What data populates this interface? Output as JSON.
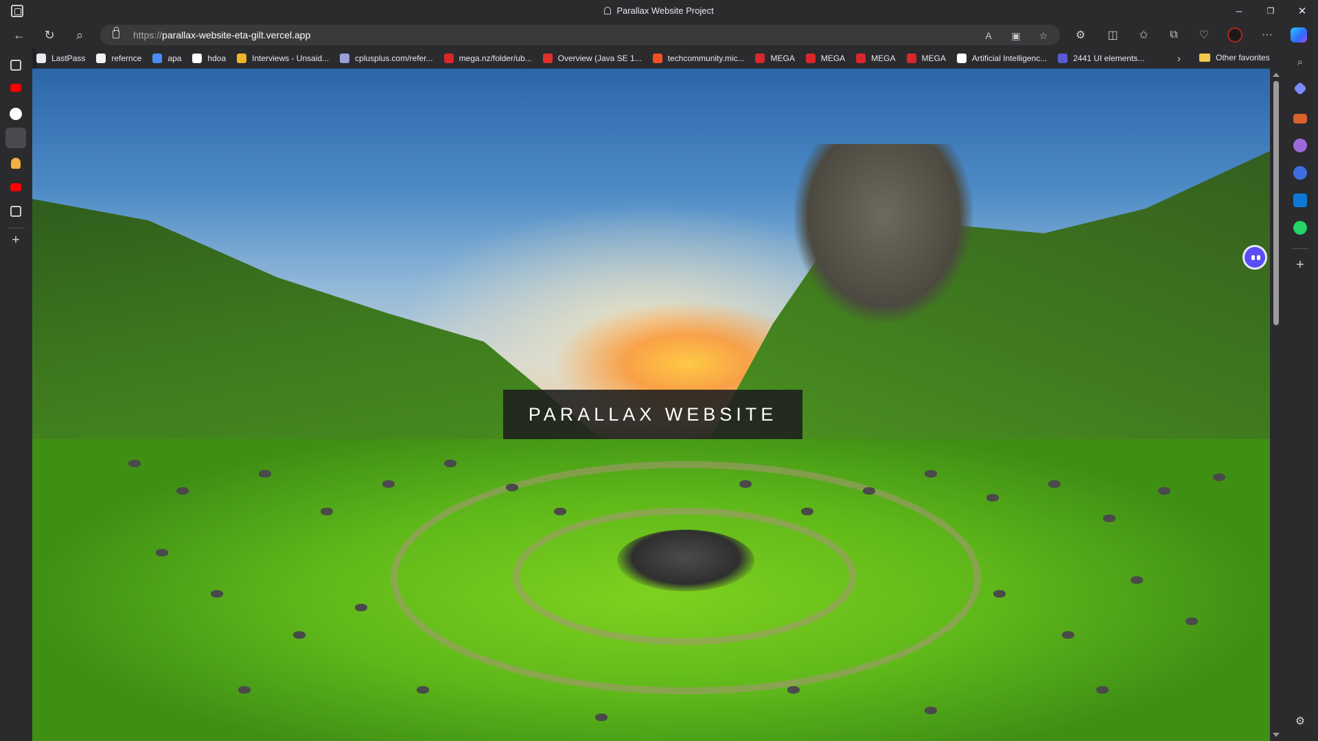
{
  "window": {
    "title": "Parallax Website Project",
    "controls": {
      "minimize": "–",
      "restore": "❐",
      "close": "✕"
    }
  },
  "address_bar": {
    "scheme": "https://",
    "host": "parallax-website-eta-gilt.vercel.app",
    "icons": [
      "read-aloud-icon",
      "immersive-reader-icon",
      "favorite-star-icon"
    ]
  },
  "toolbar": {
    "icons": [
      "extensions-icon",
      "split-screen-icon",
      "favorites-icon",
      "collections-icon",
      "browser-essentials-icon",
      "profile-icon",
      "more-menu-icon",
      "copilot-icon"
    ],
    "more_label": "···"
  },
  "bookmarks": [
    {
      "label": "LastPass",
      "color": "#e8eaed",
      "icon": "page-icon"
    },
    {
      "label": "refernce",
      "color": "#f2f2f2",
      "icon": "amazon-icon"
    },
    {
      "label": "apa",
      "color": "#4a8df6",
      "icon": "apa-icon"
    },
    {
      "label": "hdoa",
      "color": "#ffffff",
      "icon": "google-icon"
    },
    {
      "label": "Interviews - Unsaid...",
      "color": "#f0b429",
      "icon": "unsaid-icon"
    },
    {
      "label": "cplusplus.com/refer...",
      "color": "#9aa0d8",
      "icon": "cplusplus-icon"
    },
    {
      "label": "mega.nz/folder/ub...",
      "color": "#d9272e",
      "icon": "mega-icon"
    },
    {
      "label": "Overview (Java SE 1...",
      "color": "#e0312c",
      "icon": "oracle-icon"
    },
    {
      "label": "techcommunity.mic...",
      "color": "#f25022",
      "icon": "microsoft-icon"
    },
    {
      "label": "MEGA",
      "color": "#d9272e",
      "icon": "mega-icon"
    },
    {
      "label": "MEGA",
      "color": "#d9272e",
      "icon": "mega-icon"
    },
    {
      "label": "MEGA",
      "color": "#d9272e",
      "icon": "mega-icon"
    },
    {
      "label": "MEGA",
      "color": "#d9272e",
      "icon": "mega-icon"
    },
    {
      "label": "Artificial Intelligenc...",
      "color": "#ffffff",
      "icon": "ai-icon"
    },
    {
      "label": "2441 UI elements...",
      "color": "#5b5bd6",
      "icon": "uiverse-icon"
    }
  ],
  "bookmarks_other": "Other favorites",
  "page": {
    "hero_title": "PARALLAX WEBSITE"
  },
  "colors": {
    "chrome_bg": "#2b2b2e",
    "urlbar_bg": "#3a3a3d",
    "hero_box": "#1e1e1e",
    "float_button": "#5b4df5"
  }
}
